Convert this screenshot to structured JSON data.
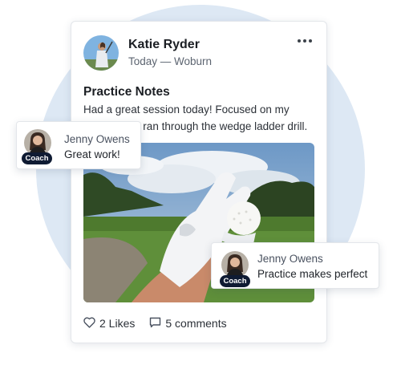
{
  "post": {
    "author": "Katie Ryder",
    "meta": "Today — Woburn",
    "title": "Practice Notes",
    "text": "Had a great session today! Focused on my putting, and ran through the wedge ladder drill.",
    "image_icon": "golf-glove-and-ball-photo",
    "likes_label": "2 Likes",
    "comments_label": "5 comments"
  },
  "comments": [
    {
      "author": "Jenny Owens",
      "badge": "Coach",
      "text": "Great work!"
    },
    {
      "author": "Jenny Owens",
      "badge": "Coach",
      "text": "Practice makes perfect"
    }
  ],
  "colors": {
    "background_circle": "#dde8f4",
    "coach_badge": "#0f1b33",
    "card": "#ffffff"
  }
}
